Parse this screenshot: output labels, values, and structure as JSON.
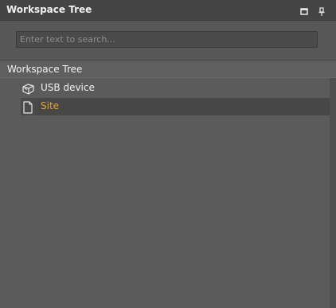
{
  "panel": {
    "title": "Workspace Tree",
    "buttons": {
      "maximize_icon": "maximize-icon",
      "pin_icon": "pin-icon"
    }
  },
  "search": {
    "placeholder": "Enter text to search...",
    "value": ""
  },
  "tree": {
    "header": "Workspace Tree",
    "nodes": [
      {
        "label": "USB device",
        "icon": "usb-device-icon",
        "selected": false
      },
      {
        "label": "Site",
        "icon": "document-icon",
        "selected": true
      }
    ]
  },
  "colors": {
    "selected_text": "#e5a33a",
    "text": "#f0f0f0",
    "background": "#5b5b5b"
  }
}
